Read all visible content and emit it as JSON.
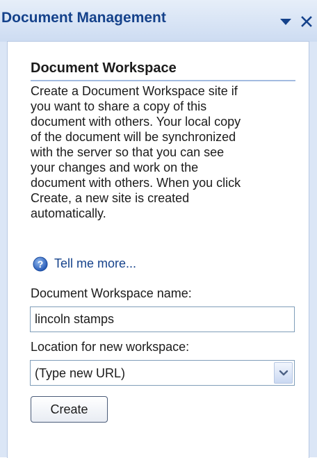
{
  "title_bar": {
    "title": "Document Management",
    "dropdown_icon": "triangle-down-icon",
    "close_icon": "x-icon"
  },
  "section": {
    "title": "Document Workspace",
    "description_lines": [
      "Create a Document Workspace site if",
      "you want to share a copy of this",
      "document with others. Your local copy",
      "of the document will be synchronized",
      "with the server so that you can see",
      "your changes and work on the",
      "document with others. When you click",
      "Create, a new site is created",
      "automatically."
    ]
  },
  "help_link": {
    "icon": "help-icon",
    "label": "Tell me more..."
  },
  "workspace_name": {
    "label": "Document Workspace name:",
    "value": "lincoln stamps"
  },
  "location": {
    "label": "Location for new workspace:",
    "selected": "(Type new URL)",
    "icon": "chevron-down-icon"
  },
  "create_button": {
    "label": "Create"
  },
  "colors": {
    "title_text": "#15428b",
    "pane_background": "#dbe6f6",
    "link": "#15428b",
    "section_rule": "#a3bbe0"
  }
}
